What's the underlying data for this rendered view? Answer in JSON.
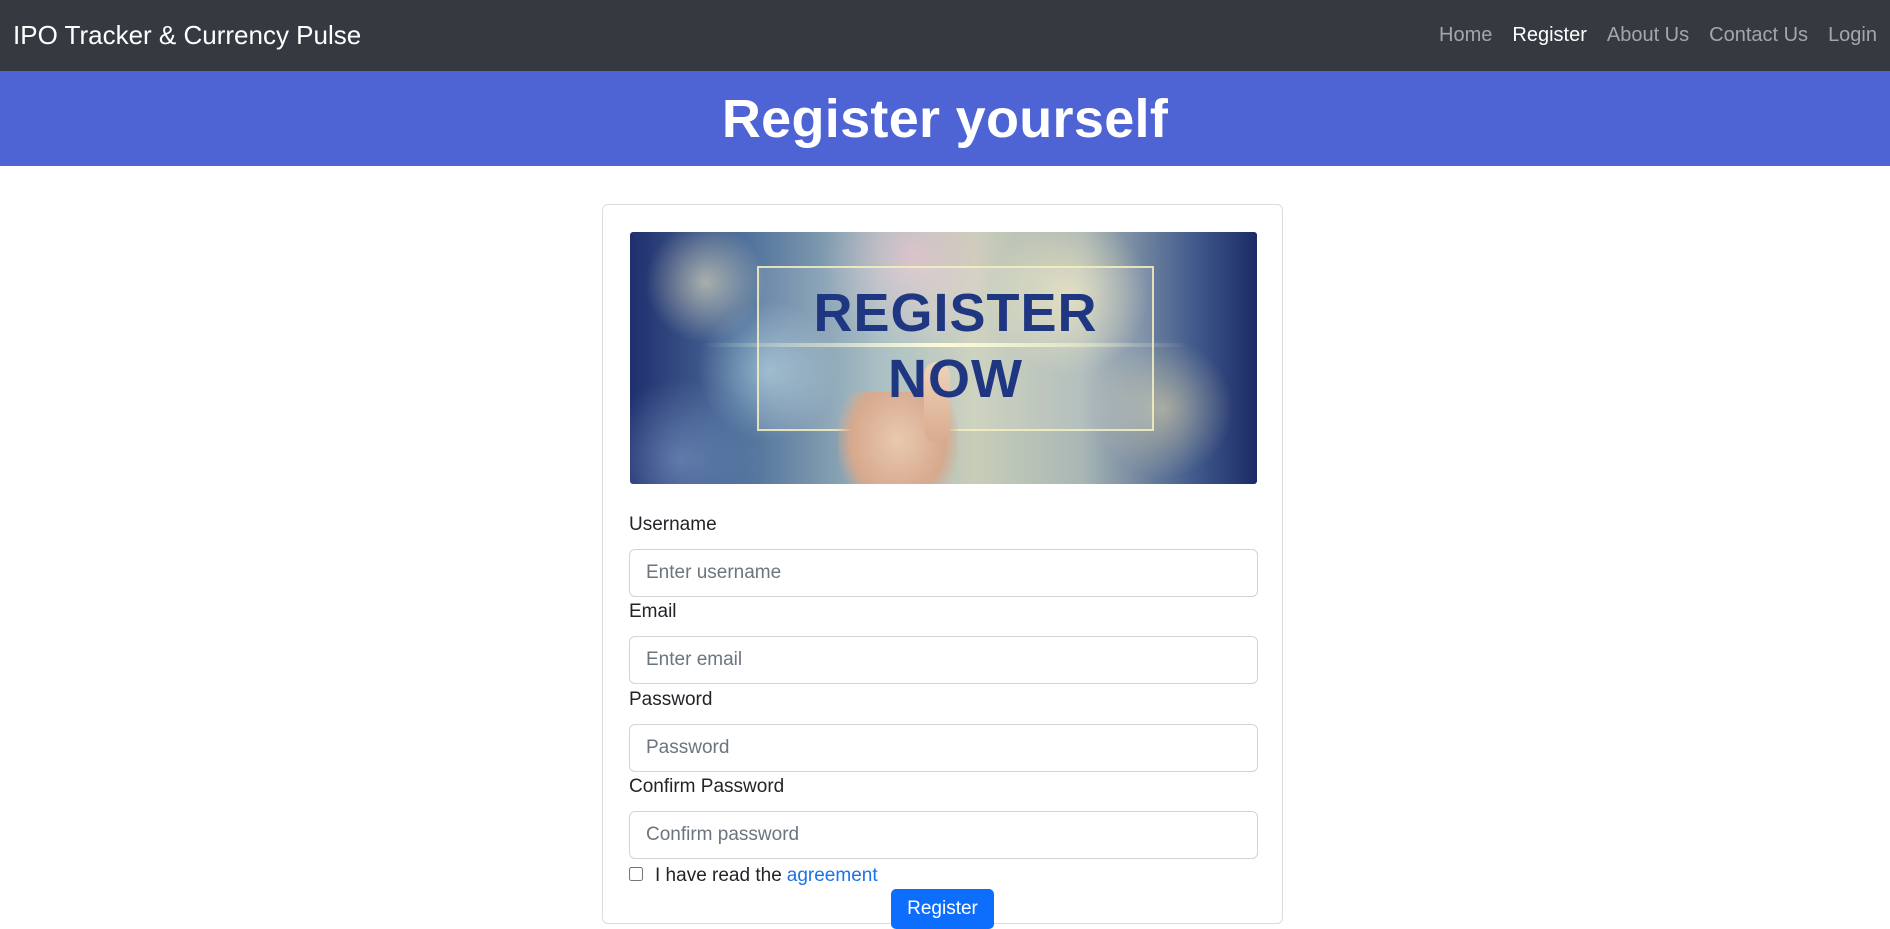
{
  "navbar": {
    "brand": "IPO Tracker & Currency Pulse",
    "links": [
      {
        "label": "Home",
        "active": false
      },
      {
        "label": "Register",
        "active": true
      },
      {
        "label": "About Us",
        "active": false
      },
      {
        "label": "Contact Us",
        "active": false
      },
      {
        "label": "Login",
        "active": false
      }
    ]
  },
  "hero": {
    "title": "Register yourself"
  },
  "banner": {
    "line1": "REGISTER",
    "line2": "NOW"
  },
  "form": {
    "username": {
      "label": "Username",
      "placeholder": "Enter username",
      "value": ""
    },
    "email": {
      "label": "Email",
      "placeholder": "Enter email",
      "value": ""
    },
    "password": {
      "label": "Password",
      "placeholder": "Password",
      "value": ""
    },
    "confirm_password": {
      "label": "Confirm Password",
      "placeholder": "Confirm password",
      "value": ""
    },
    "agreement": {
      "text": "I have read the",
      "link": "agreement",
      "checked": false
    },
    "submit_label": "Register"
  },
  "colors": {
    "navbar_bg": "#343a40",
    "hero_bg": "#4e64d4",
    "primary": "#0d6efd",
    "link": "#1a73e8"
  }
}
